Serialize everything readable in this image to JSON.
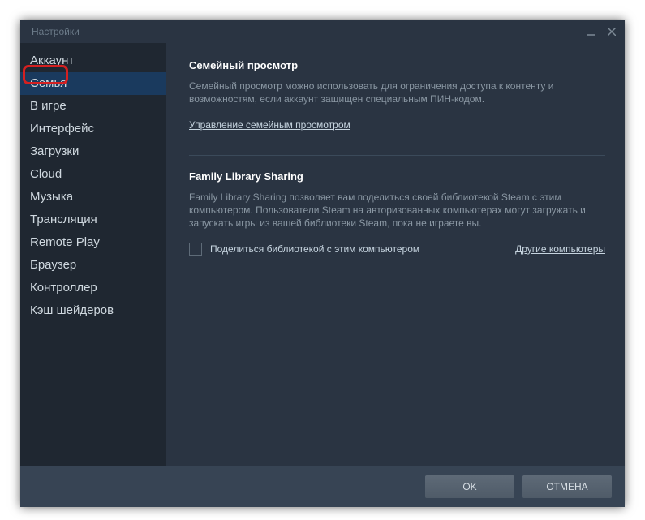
{
  "window": {
    "title": "Настройки"
  },
  "sidebar": {
    "items": [
      {
        "label": "Аккаунт"
      },
      {
        "label": "Семья"
      },
      {
        "label": "В игре"
      },
      {
        "label": "Интерфейс"
      },
      {
        "label": "Загрузки"
      },
      {
        "label": "Cloud"
      },
      {
        "label": "Музыка"
      },
      {
        "label": "Трансляция"
      },
      {
        "label": "Remote Play"
      },
      {
        "label": "Браузер"
      },
      {
        "label": "Контроллер"
      },
      {
        "label": "Кэш шейдеров"
      }
    ],
    "active_index": 1
  },
  "family_view": {
    "title": "Семейный просмотр",
    "description": "Семейный просмотр можно использовать для ограничения доступа к контенту и возможностям, если аккаунт защищен специальным ПИН-кодом.",
    "manage_link": "Управление семейным просмотром"
  },
  "family_sharing": {
    "title": "Family Library Sharing",
    "description": "Family Library Sharing позволяет вам поделиться своей библиотекой Steam с этим компьютером. Пользователи Steam на авторизованных компьютерах могут загружать и запускать игры из вашей библиотеки Steam, пока не играете вы.",
    "checkbox_label": "Поделиться библиотекой с этим компьютером",
    "checkbox_checked": false,
    "other_link": "Другие компьютеры"
  },
  "footer": {
    "ok": "OK",
    "cancel": "ОТМЕНА"
  }
}
